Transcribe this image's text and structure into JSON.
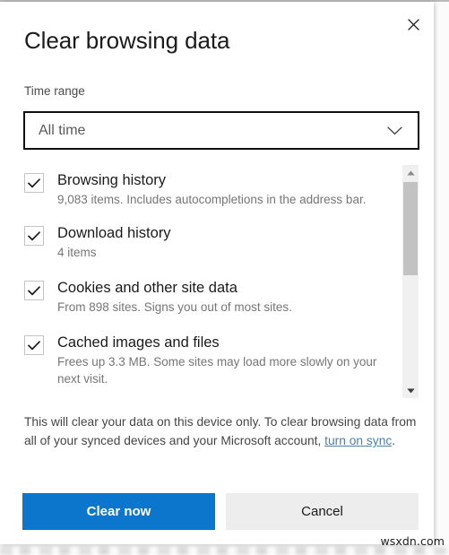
{
  "dialog": {
    "title": "Clear browsing data",
    "close_icon": "close-icon"
  },
  "time_range": {
    "label": "Time range",
    "selected": "All time",
    "chevron_icon": "chevron-down-icon"
  },
  "options": [
    {
      "title": "Browsing history",
      "subtitle": "9,083 items. Includes autocompletions in the address bar.",
      "checked": "✓"
    },
    {
      "title": "Download history",
      "subtitle": "4 items",
      "checked": "✓"
    },
    {
      "title": "Cookies and other site data",
      "subtitle": "From 898 sites. Signs you out of most sites.",
      "checked": "✓"
    },
    {
      "title": "Cached images and files",
      "subtitle": "Frees up 3.3 MB. Some sites may load more slowly on your next visit.",
      "checked": "✓"
    }
  ],
  "scrollbar": {
    "up_icon": "scroll-up-arrow-icon",
    "down_icon": "scroll-down-arrow-icon"
  },
  "note": {
    "text_before": "This will clear your data on this device only. To clear browsing data from all of your synced devices and your Microsoft account, ",
    "link_text": "turn on sync",
    "text_after": "."
  },
  "buttons": {
    "primary": "Clear now",
    "secondary": "Cancel"
  },
  "watermark": "wsxdn.com",
  "colors": {
    "accent_blue": "#0b76cc",
    "link_blue": "#4d7fa8",
    "secondary_button": "#ededed",
    "scroll_thumb": "#c2c2c2",
    "scroll_track": "#f0f0f0",
    "title_text": "#1b1b1b",
    "subtitle_text": "#767676"
  }
}
